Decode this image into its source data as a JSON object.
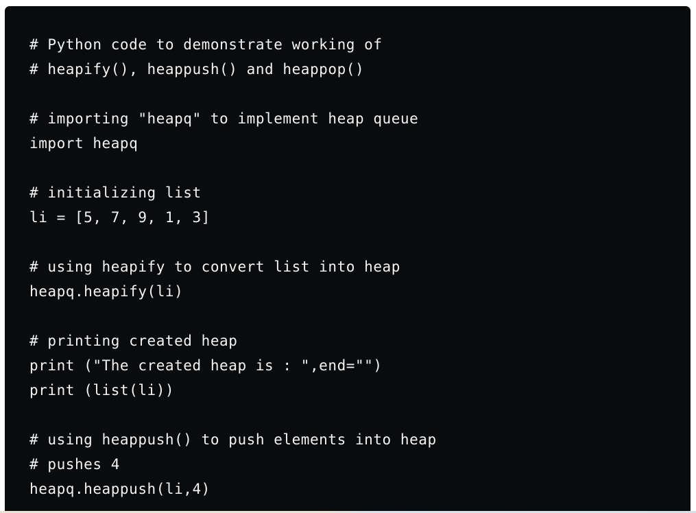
{
  "code_block": {
    "language": "python",
    "lines": [
      "# Python code to demonstrate working of",
      "# heapify(), heappush() and heappop()",
      "",
      "# importing \"heapq\" to implement heap queue",
      "import heapq",
      "",
      "# initializing list",
      "li = [5, 7, 9, 1, 3]",
      "",
      "# using heapify to convert list into heap",
      "heapq.heapify(li)",
      "",
      "# printing created heap",
      "print (\"The created heap is : \",end=\"\")",
      "print (list(li))",
      "",
      "# using heappush() to push elements into heap",
      "# pushes 4",
      "heapq.heappush(li,4)"
    ]
  },
  "colors": {
    "code_background": "#0a0b0d",
    "code_text": "#f3f3f3"
  }
}
